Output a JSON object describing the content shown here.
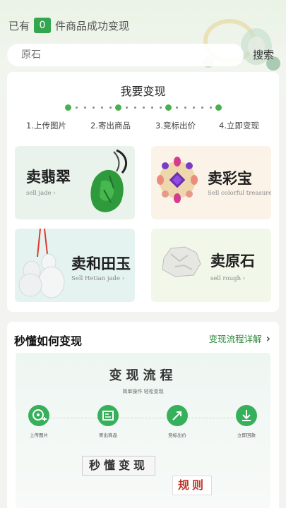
{
  "header": {
    "success_prefix": "已有",
    "success_count": "0",
    "success_suffix": "件商品成功变现"
  },
  "search": {
    "placeholder": "原石",
    "button_label": "搜索"
  },
  "sell_card": {
    "title": "我要变现",
    "steps": [
      "1.上传图片",
      "2.寄出商品",
      "3.竞标出价",
      "4.立即变现"
    ],
    "tiles": [
      {
        "title": "卖翡翠",
        "subtitle": "sell jade ›"
      },
      {
        "title": "卖彩宝",
        "subtitle": "Sell colorful treasures ›"
      },
      {
        "title": "卖和田玉",
        "subtitle": "Sell Hetian jade ›"
      },
      {
        "title": "卖原石",
        "subtitle": "sell rough ›"
      }
    ]
  },
  "howto_card": {
    "title": "秒懂如何变现",
    "link_label": "变现流程详解",
    "flow_title": "变现流程",
    "flow_subtitle": "简单操作 轻松变现",
    "flow_steps": [
      "上传图片",
      "寄出商品",
      "竞标出价",
      "立即回款"
    ],
    "rules_line1": "秒懂变现",
    "rules_line2": "规则"
  },
  "colors": {
    "accent": "#33a64f",
    "jade_tile": "#e9f3ec",
    "gem_tile": "#fbf3e8",
    "hetian_tile": "#e4f3f0",
    "rough_tile": "#f1f7e9"
  }
}
